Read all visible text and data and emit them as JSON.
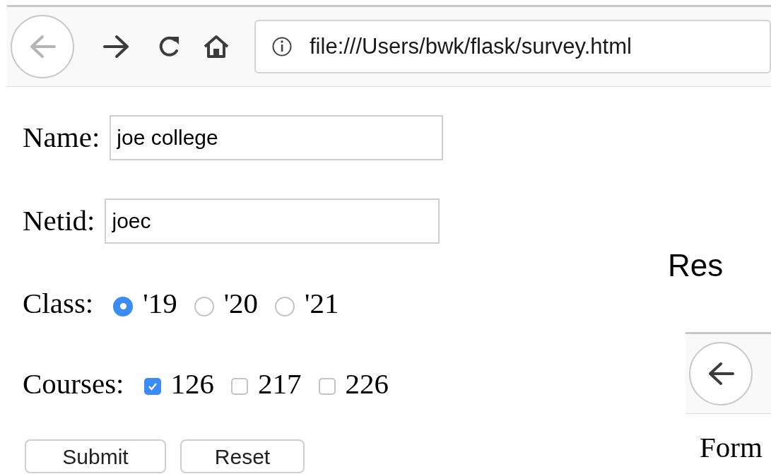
{
  "browser": {
    "back_disabled": true,
    "url": "file:///Users/bwk/flask/survey.html"
  },
  "form": {
    "fields": [
      {
        "label": "Name:",
        "value": "joe college"
      },
      {
        "label": "Netid:",
        "value": "joec"
      }
    ],
    "class": {
      "label": "Class:",
      "options": [
        {
          "label": "'19",
          "selected": true
        },
        {
          "label": "'20",
          "selected": false
        },
        {
          "label": "'21",
          "selected": false
        }
      ]
    },
    "courses": {
      "label": "Courses:",
      "options": [
        {
          "label": "126",
          "checked": true
        },
        {
          "label": "217",
          "checked": false
        },
        {
          "label": "226",
          "checked": false
        }
      ]
    },
    "buttons": [
      "Submit",
      "Reset"
    ]
  },
  "response": {
    "heading": "Res",
    "browser": {
      "back_disabled": false
    },
    "text": "Form"
  }
}
